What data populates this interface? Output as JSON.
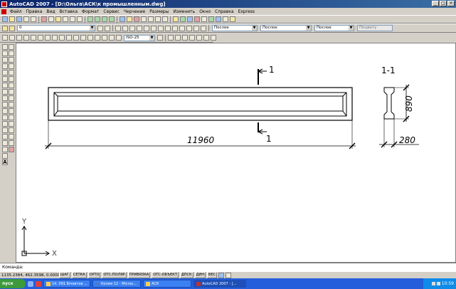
{
  "window": {
    "title": "AutoCAD 2007 - [D:\\Ольга\\АСК\\к промышленным.dwg]",
    "min": "_",
    "max": "□",
    "close": "×"
  },
  "menu": [
    "Файл",
    "Правка",
    "Вид",
    "Вставка",
    "Формат",
    "Сервис",
    "Черчение",
    "Размеры",
    "Изменить",
    "Окно",
    "Справка",
    "Express"
  ],
  "layer": {
    "current": "0"
  },
  "properties": {
    "color": "Послое",
    "linetype": "Послое",
    "lineweight": "Послое",
    "plotstyle": "Поцвету"
  },
  "dimstyle": {
    "current": "ISO-25"
  },
  "drawing": {
    "section_mark": "1",
    "section_title": "1-1",
    "dim_length": "11960",
    "dim_height": "890",
    "dim_width": "280",
    "ucs_x": "X",
    "ucs_y": "Y"
  },
  "command": {
    "prompt": "Команда:"
  },
  "status": {
    "coords": "1135.2384, 462.3598, 0.0000",
    "buttons": [
      "ШАГ",
      "СЕТКА",
      "ОРТО",
      "ОТС-ПОЛЯР",
      "ПРИВЯЗКА",
      "ОТС-ОБЪЕКТ",
      "ДПСК",
      "ДИН",
      "ВЕС"
    ]
  },
  "taskbar": {
    "start": "пуск",
    "items": [
      "14. 091 Бічевтов ...",
      "Копия 12 - Micros...",
      "АСК",
      "AutoCAD 2007 - [..."
    ],
    "clock": "10:59"
  },
  "colors": {
    "title_left": "#0a246a",
    "title_right": "#3a6ea5",
    "taskbar": "#245edb"
  }
}
